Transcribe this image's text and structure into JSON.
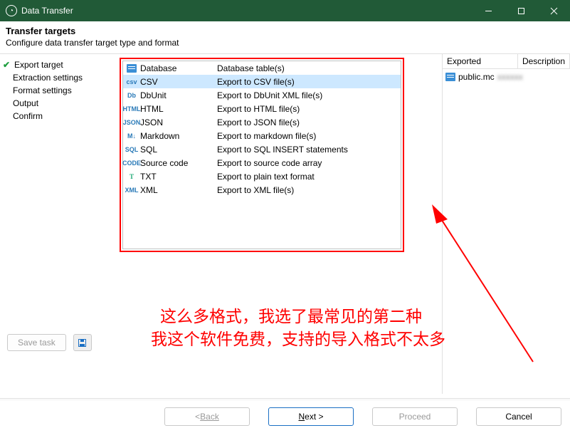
{
  "window": {
    "title": "Data Transfer"
  },
  "header": {
    "title": "Transfer targets",
    "subtitle": "Configure data transfer target type and format"
  },
  "nav": {
    "items": [
      {
        "label": "Export target",
        "current": true
      },
      {
        "label": "Extraction settings"
      },
      {
        "label": "Format settings"
      },
      {
        "label": "Output"
      },
      {
        "label": "Confirm"
      }
    ]
  },
  "formats": [
    {
      "name": "Database",
      "desc": "Database table(s)",
      "icon": "db"
    },
    {
      "name": "CSV",
      "desc": "Export to CSV file(s)",
      "icon": "csv",
      "selected": true
    },
    {
      "name": "DbUnit",
      "desc": "Export to DbUnit XML file(s)",
      "icon": "dbunit"
    },
    {
      "name": "HTML",
      "desc": "Export to HTML file(s)",
      "icon": "html"
    },
    {
      "name": "JSON",
      "desc": "Export to JSON file(s)",
      "icon": "json"
    },
    {
      "name": "Markdown",
      "desc": "Export to markdown file(s)",
      "icon": "md"
    },
    {
      "name": "SQL",
      "desc": "Export to SQL INSERT statements",
      "icon": "sql"
    },
    {
      "name": "Source code",
      "desc": "Export to source code array",
      "icon": "code"
    },
    {
      "name": "TXT",
      "desc": "Export to plain text format",
      "icon": "txt"
    },
    {
      "name": "XML",
      "desc": "Export to XML file(s)",
      "icon": "xml"
    }
  ],
  "right": {
    "col1": "Exported",
    "col2": "Description",
    "object": "public.mc"
  },
  "save": {
    "save_task": "Save task"
  },
  "footer": {
    "back": "Back",
    "next": "Next >",
    "proceed": "Proceed",
    "cancel": "Cancel"
  },
  "annotation": {
    "line1": "这么多格式，我选了最常见的第二种",
    "line2": "我这个软件免费，支持的导入格式不太多"
  },
  "colors": {
    "titlebar": "#215a37",
    "selection": "#cde8ff",
    "annotation": "#ff0000",
    "primary_border": "#1a6fc4"
  }
}
